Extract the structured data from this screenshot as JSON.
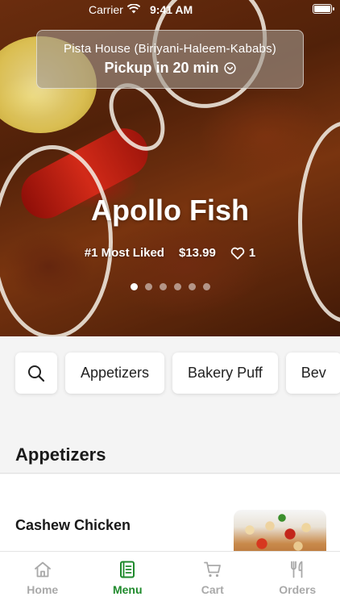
{
  "status_bar": {
    "carrier": "Carrier",
    "time": "9:41 AM"
  },
  "header": {
    "store_name": "Pista House (Biriyani-Haleem-Kababs)",
    "pickup_text": "Pickup in 20 min"
  },
  "hero": {
    "dish_name": "Apollo Fish",
    "rank_label": "#1 Most Liked",
    "price": "$13.99",
    "likes": "1",
    "slide_count": 6,
    "active_slide": 1
  },
  "categories": {
    "items": [
      "Appetizers",
      "Bakery Puff",
      "Bev"
    ]
  },
  "section": {
    "title": "Appetizers",
    "items": [
      {
        "name": "Cashew Chicken"
      }
    ]
  },
  "tab_bar": {
    "tabs": [
      {
        "label": "Home",
        "icon": "home-icon"
      },
      {
        "label": "Menu",
        "icon": "menu-icon",
        "active": true
      },
      {
        "label": "Cart",
        "icon": "cart-icon"
      },
      {
        "label": "Orders",
        "icon": "orders-icon"
      }
    ]
  },
  "colors": {
    "accent": "#1f8a2c",
    "inactive": "#a9a9a9"
  }
}
